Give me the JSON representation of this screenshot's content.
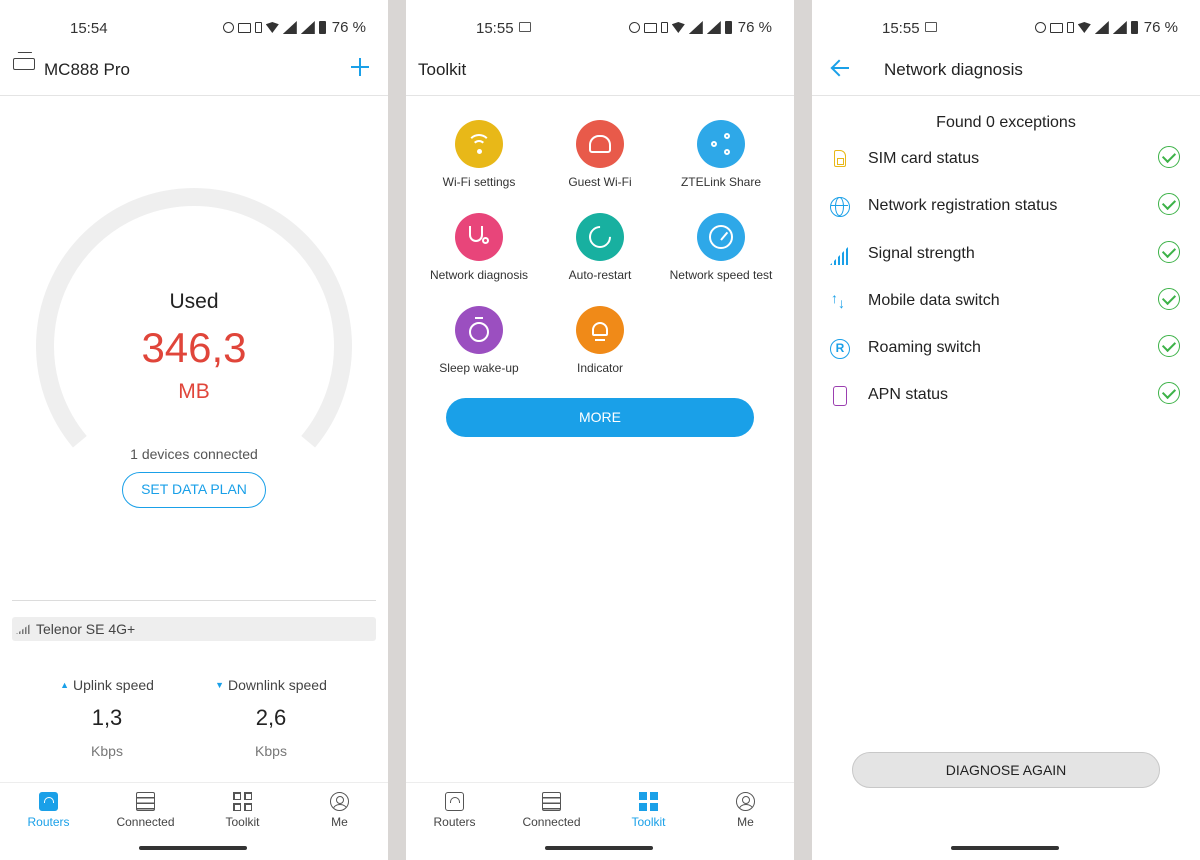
{
  "colors": {
    "accent": "#1aa0e8",
    "used_value": "#e0453a",
    "check_ok": "#3db248"
  },
  "screen1": {
    "status": {
      "time": "15:54",
      "battery": "76 %"
    },
    "header": {
      "title": "MC888 Pro",
      "add_icon": "plus-icon",
      "router_icon": "router-icon"
    },
    "gauge": {
      "label": "Used",
      "value": "346,3",
      "unit": "MB"
    },
    "devices_connected": "1 devices connected",
    "set_data_plan": "SET DATA PLAN",
    "operator": "Telenor SE 4G+",
    "uplink": {
      "label": "Uplink speed",
      "value": "1,3",
      "unit": "Kbps"
    },
    "downlink": {
      "label": "Downlink speed",
      "value": "2,6",
      "unit": "Kbps"
    }
  },
  "screen2": {
    "status": {
      "time": "15:55",
      "battery": "76 %"
    },
    "header": {
      "title": "Toolkit"
    },
    "tools": [
      {
        "label": "Wi-Fi settings",
        "color": "#e8b818",
        "icon": "wifi-icon"
      },
      {
        "label": "Guest Wi-Fi",
        "color": "#e85a4a",
        "icon": "guests-icon"
      },
      {
        "label": "ZTELink Share",
        "color": "#2ea8e8",
        "icon": "share-icon"
      },
      {
        "label": "Network diagnosis",
        "color": "#e8457a",
        "icon": "stethoscope-icon"
      },
      {
        "label": "Auto-restart",
        "color": "#18b0a0",
        "icon": "restart-icon"
      },
      {
        "label": "Network speed test",
        "color": "#2ea8e8",
        "icon": "speedometer-icon"
      },
      {
        "label": "Sleep wake-up",
        "color": "#9b4fc0",
        "icon": "timer-icon"
      },
      {
        "label": "Indicator",
        "color": "#f08a18",
        "icon": "lightbulb-icon"
      }
    ],
    "more": "MORE"
  },
  "screen3": {
    "status": {
      "time": "15:55",
      "battery": "76 %"
    },
    "header": {
      "title": "Network diagnosis"
    },
    "found": "Found 0 exceptions",
    "checks": [
      {
        "label": "SIM card status",
        "icon": "sim-card-icon",
        "status": "ok"
      },
      {
        "label": "Network registration status",
        "icon": "globe-icon",
        "status": "ok"
      },
      {
        "label": "Signal strength",
        "icon": "signal-icon",
        "status": "ok"
      },
      {
        "label": "Mobile data switch",
        "icon": "up-down-arrows-icon",
        "status": "ok"
      },
      {
        "label": "Roaming switch",
        "icon": "roaming-icon",
        "status": "ok"
      },
      {
        "label": "APN status",
        "icon": "apn-icon",
        "status": "ok"
      }
    ],
    "diagnose_again": "DIAGNOSE AGAIN"
  },
  "nav": {
    "items": [
      {
        "label": "Routers",
        "icon": "router-icon"
      },
      {
        "label": "Connected",
        "icon": "list-icon"
      },
      {
        "label": "Toolkit",
        "icon": "grid-icon"
      },
      {
        "label": "Me",
        "icon": "profile-icon"
      }
    ],
    "screen1_active": "Routers",
    "screen2_active": "Toolkit"
  }
}
